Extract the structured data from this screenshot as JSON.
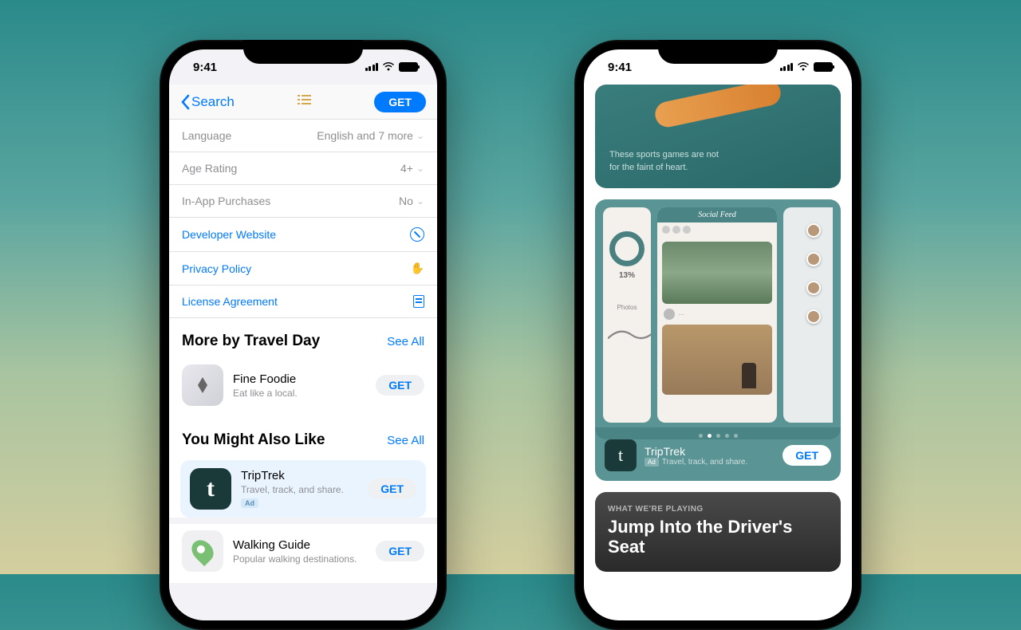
{
  "status": {
    "time": "9:41"
  },
  "leftPhone": {
    "nav": {
      "back": "Search",
      "get": "GET"
    },
    "info": [
      {
        "label": "Language",
        "value": "English and 7 more",
        "type": "chevron"
      },
      {
        "label": "Age Rating",
        "value": "4+",
        "type": "chevron"
      },
      {
        "label": "In-App Purchases",
        "value": "No",
        "type": "chevron"
      },
      {
        "label": "Developer Website",
        "value": "",
        "type": "link-safari"
      },
      {
        "label": "Privacy Policy",
        "value": "",
        "type": "link-hand"
      },
      {
        "label": "License Agreement",
        "value": "",
        "type": "link-doc"
      }
    ],
    "sections": {
      "moreBy": {
        "title": "More by Travel Day",
        "seeAll": "See All"
      },
      "youMight": {
        "title": "You Might Also Like",
        "seeAll": "See All"
      }
    },
    "apps": {
      "fineFoodie": {
        "name": "Fine Foodie",
        "sub": "Eat like a local.",
        "get": "GET"
      },
      "tripTrek": {
        "name": "TripTrek",
        "sub": "Travel, track, and share.",
        "ad": "Ad",
        "get": "GET"
      },
      "walkingGuide": {
        "name": "Walking Guide",
        "sub": "Popular walking destinations.",
        "get": "GET"
      }
    }
  },
  "rightPhone": {
    "hero": {
      "text": "These sports games are not for the faint of heart."
    },
    "screenshots": {
      "socialFeed": "Social Feed",
      "donutValue": "13%",
      "photosLabel": "Photos"
    },
    "promo": {
      "name": "TripTrek",
      "sub": "Travel, track, and share.",
      "ad": "Ad",
      "get": "GET"
    },
    "editorial": {
      "eyebrow": "WHAT WE'RE PLAYING",
      "title": "Jump Into the Driver's Seat"
    }
  }
}
